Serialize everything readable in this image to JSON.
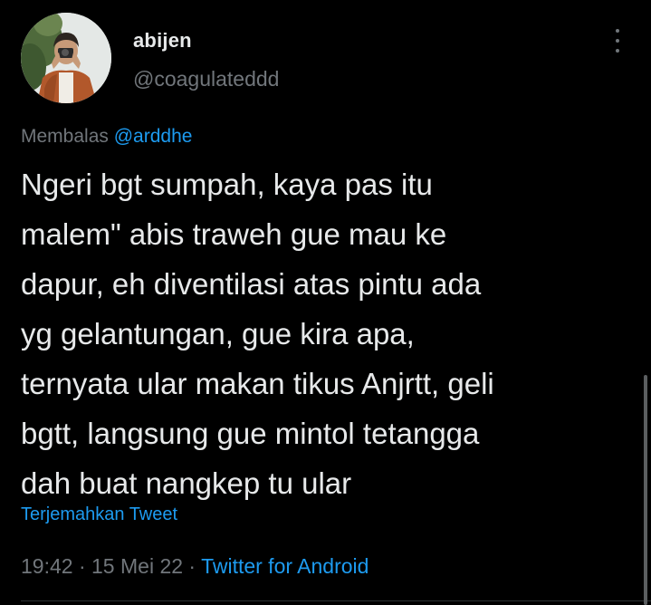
{
  "user": {
    "display_name": "abijen",
    "handle": "@coagulateddd"
  },
  "reply": {
    "prefix": "Membalas",
    "mention": "@arddhe"
  },
  "tweet": {
    "text": "Ngeri bgt sumpah, kaya pas itu\nmalem\" abis traweh gue mau ke\ndapur, eh diventilasi atas pintu ada\nyg gelantungan, gue kira apa,\nternyata ular makan tikus Anjrtt, geli\nbgtt, langsung gue mintol tetangga\ndah buat nangkep tu ular",
    "translate_label": "Terjemahkan Tweet"
  },
  "meta": {
    "time": "19:42",
    "sep1": " · ",
    "date": "15 Mei 22",
    "sep2": " · ",
    "source": "Twitter for Android"
  },
  "icons": {
    "more": "more-vertical-icon"
  },
  "colors": {
    "background": "#000000",
    "primary_text": "#e7e9ea",
    "secondary_text": "#71767b",
    "link": "#1d9bf0"
  }
}
